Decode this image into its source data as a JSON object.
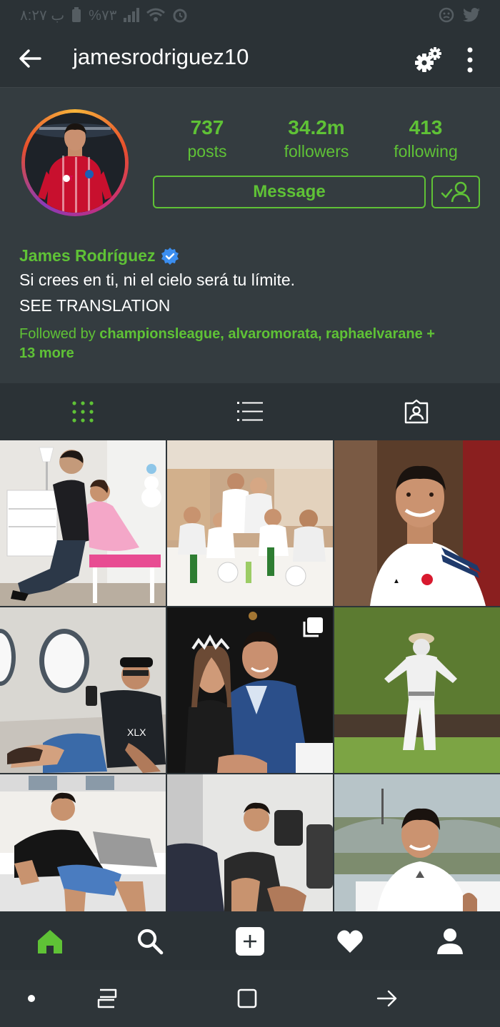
{
  "status_bar": {
    "time": "۸:۲۷ ب",
    "battery": "%۷۳"
  },
  "header": {
    "username": "jamesrodriguez10"
  },
  "profile": {
    "stats": [
      {
        "value": "737",
        "label": "posts"
      },
      {
        "value": "34.2m",
        "label": "followers"
      },
      {
        "value": "413",
        "label": "following"
      }
    ],
    "message_button": "Message",
    "name": "James Rodríguez",
    "verified": true,
    "bio": "Si crees en ti, ni el cielo será tu límite.",
    "see_translation": "SEE TRANSLATION",
    "followed_by_prefix": "Followed by",
    "followed_by_accounts": "championsleague, alvaromorata, raphaelvarane +",
    "followed_by_more": "13 more"
  },
  "tabs": [
    {
      "icon": "grid-icon",
      "active": true
    },
    {
      "icon": "list-icon",
      "active": false
    },
    {
      "icon": "tagged-icon",
      "active": false
    }
  ],
  "posts": [
    {
      "scene": "father braiding daughter's hair in white room"
    },
    {
      "scene": "team dinner group photo"
    },
    {
      "scene": "smiling portrait in white jersey"
    },
    {
      "scene": "reclining on private jet with phone"
    },
    {
      "scene": "with daughter wearing crown, blue suit",
      "multi": true
    },
    {
      "scene": "scarecrow on green lawn"
    },
    {
      "scene": "lying on white sofa"
    },
    {
      "scene": "sitting on gym machine"
    },
    {
      "scene": "smiling on terrace with hills behind"
    }
  ],
  "bottom_nav": [
    "home-icon",
    "search-icon",
    "add-icon",
    "heart-icon",
    "profile-icon"
  ],
  "colors": {
    "accent": "#5fc236",
    "background": "#2e3539",
    "bar": "#2b3236",
    "verified": "#3b8ef0"
  }
}
